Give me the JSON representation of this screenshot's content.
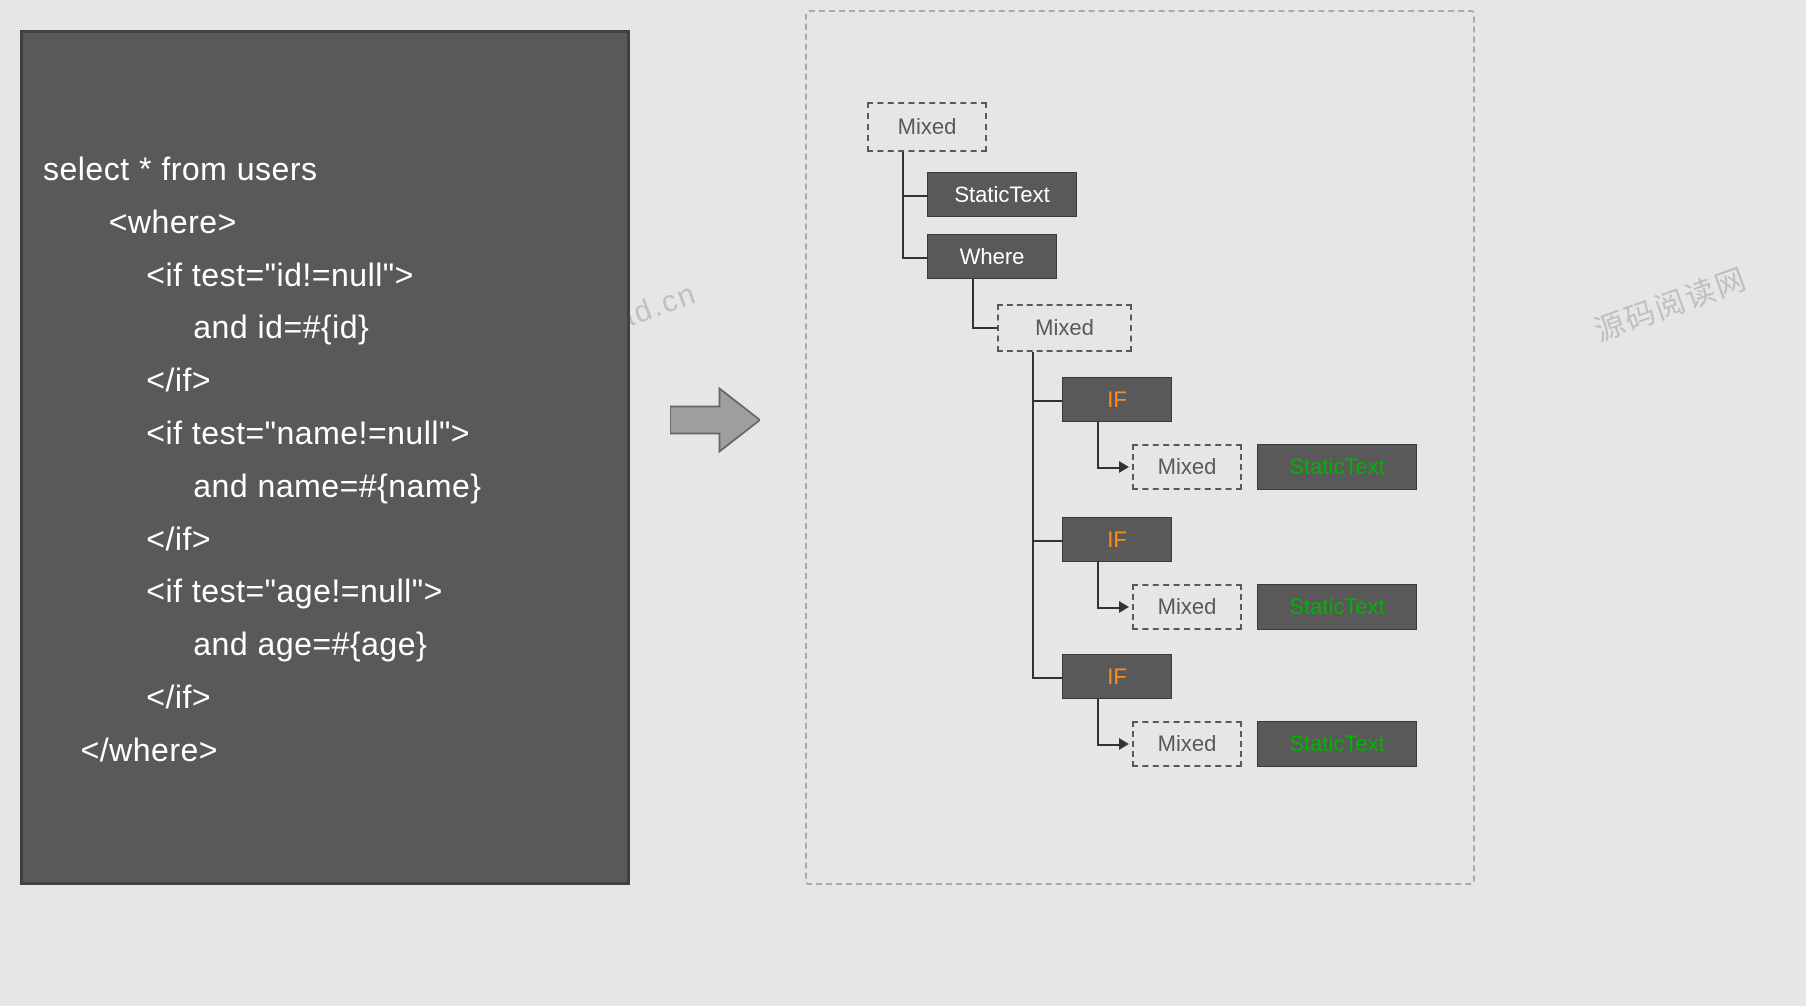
{
  "code_block": {
    "lines": [
      "select * from users",
      "       <where>",
      "           <if test=\"id!=null\">",
      "                and id=#{id}",
      "           </if>",
      "           <if test=\"name!=null\">",
      "                and name=#{name}",
      "           </if>",
      "           <if test=\"age!=null\">",
      "                and age=#{age}",
      "           </if>",
      "    </where>"
    ]
  },
  "tree": {
    "root": {
      "label": "Mixed"
    },
    "static_text": {
      "label": "StaticText"
    },
    "where": {
      "label": "Where"
    },
    "mixed_2": {
      "label": "Mixed"
    },
    "branches": [
      {
        "if_label": "IF",
        "mixed_label": "Mixed",
        "leaf_label": "StaticText"
      },
      {
        "if_label": "IF",
        "mixed_label": "Mixed",
        "leaf_label": "StaticText"
      },
      {
        "if_label": "IF",
        "mixed_label": "Mixed",
        "leaf_label": "StaticText"
      }
    ]
  },
  "watermarks": {
    "left": "ad.cn",
    "right": "源码阅读网"
  }
}
